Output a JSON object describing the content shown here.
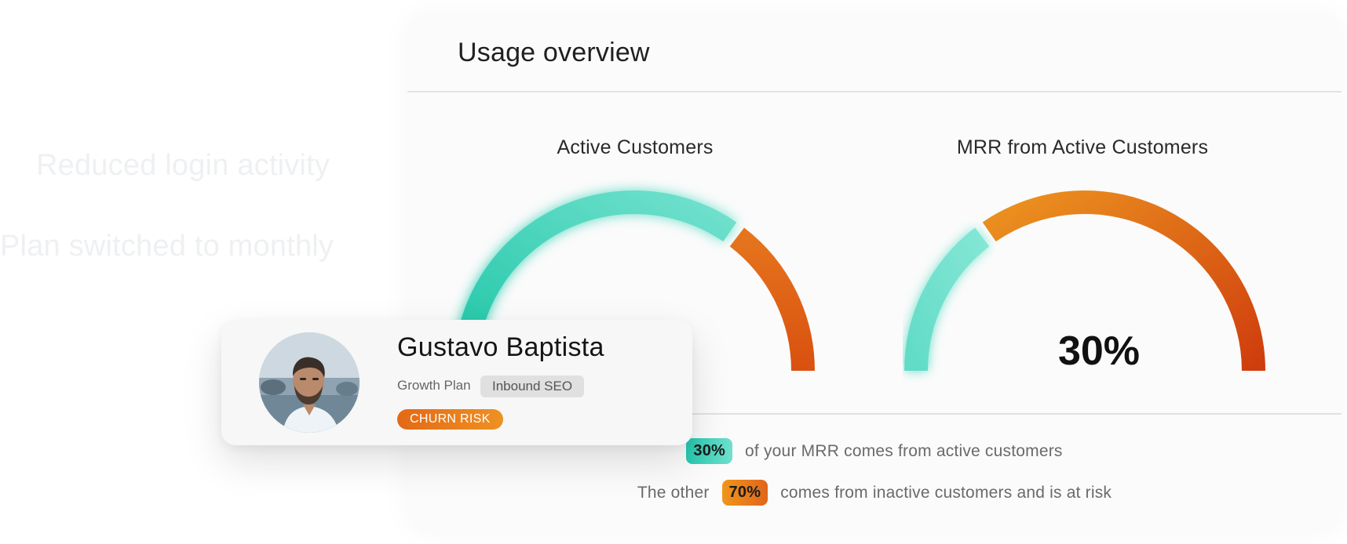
{
  "background": {
    "ghost_items": [
      "Reduced login activity",
      "Plan switched to monthly"
    ]
  },
  "usage_overview": {
    "title": "Usage overview",
    "gauges": [
      {
        "label": "Active Customers",
        "value_text": "",
        "active_fraction": 0.7,
        "colors": {
          "active": "#34d0b6",
          "risk": "#e15e14"
        }
      },
      {
        "label": "MRR from Active Customers",
        "value_text": "30%",
        "active_fraction": 0.3,
        "colors": {
          "active": "#6fdfcb",
          "risk": "#e1621a"
        }
      }
    ],
    "summary": {
      "active_pill": "30%",
      "active_text": "of your MRR comes from active customers",
      "other_prefix": "The other",
      "risk_pill": "70%",
      "risk_text": "comes from inactive customers and is at risk"
    }
  },
  "profile": {
    "name": "Gustavo Baptista",
    "plan": "Growth Plan",
    "tag": "Inbound SEO",
    "badge": "CHURN RISK"
  },
  "colors": {
    "teal": "#2ccbb0",
    "orange": "#e8761a",
    "card_bg": "#fbfbfb"
  }
}
